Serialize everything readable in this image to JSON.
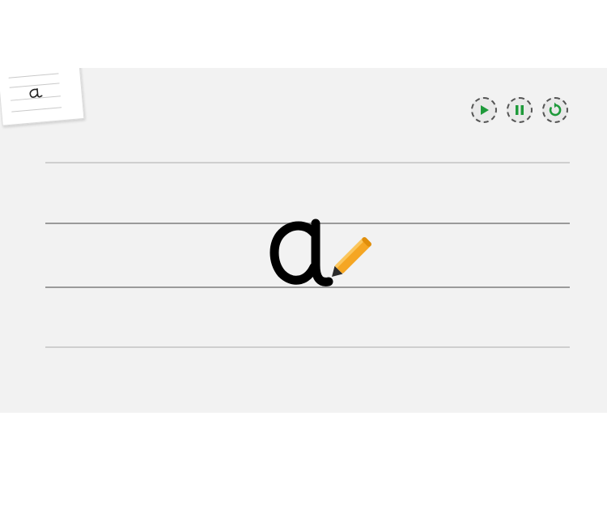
{
  "lesson": {
    "letter": "α",
    "preview_letter": "α"
  },
  "controls": {
    "play_icon": "play-icon",
    "pause_icon": "pause-icon",
    "replay_icon": "replay-icon",
    "accent_color": "#1e9a3a"
  },
  "pen": {
    "icon": "pencil-icon",
    "color": "#f5a623"
  }
}
